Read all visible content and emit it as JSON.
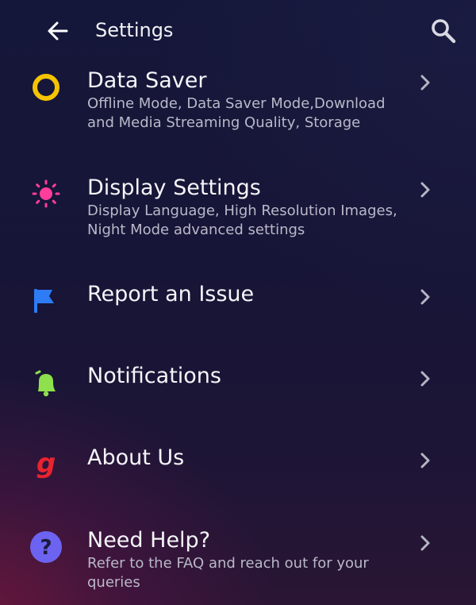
{
  "header": {
    "title": "Settings"
  },
  "items": [
    {
      "title": "Data Saver",
      "desc": "Offline Mode, Data Saver Mode,Download and Media Streaming Quality, Storage",
      "icon": "ring-icon",
      "icon_color": "#f5c400"
    },
    {
      "title": "Display Settings",
      "desc": "Display Language, High Resolution Images, Night Mode advanced settings",
      "icon": "sun-icon",
      "icon_color": "#ff3d9a"
    },
    {
      "title": "Report an Issue",
      "desc": "",
      "icon": "flag-icon",
      "icon_color": "#2d7cf6"
    },
    {
      "title": "Notifications",
      "desc": "",
      "icon": "bell-icon",
      "icon_color": "#8ee04c"
    },
    {
      "title": "About Us",
      "desc": "",
      "icon": "gaana-logo-icon",
      "icon_text": "g",
      "icon_color": "#e8242e"
    },
    {
      "title": "Need Help?",
      "desc": "Refer to the FAQ and reach out for your queries",
      "icon": "help-icon",
      "icon_text": "?",
      "icon_color": "#6c63f0"
    }
  ]
}
